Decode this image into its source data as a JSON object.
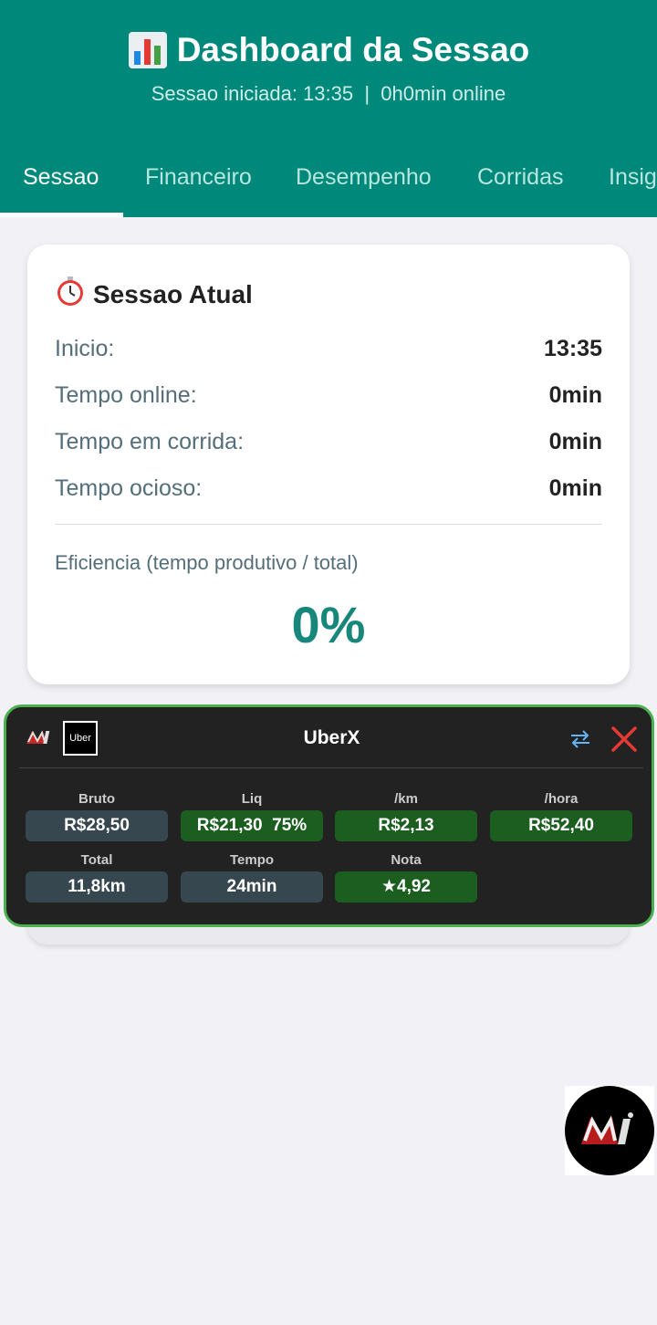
{
  "header": {
    "title": "Dashboard da Sessao",
    "subtitle": "Sessao iniciada: 13:35  |  0h0min online",
    "title_icon": "bar-chart-icon"
  },
  "tabs": [
    {
      "label": "Sessao",
      "active": true
    },
    {
      "label": "Financeiro",
      "active": false
    },
    {
      "label": "Desempenho",
      "active": false
    },
    {
      "label": "Corridas",
      "active": false
    },
    {
      "label": "Insig",
      "active": false
    }
  ],
  "session_card": {
    "icon": "stopwatch-icon",
    "title": "Sessao Atual",
    "rows": [
      {
        "label": "Inicio:",
        "value": "13:35"
      },
      {
        "label": "Tempo online:",
        "value": "0min"
      },
      {
        "label": "Tempo em corrida:",
        "value": "0min"
      },
      {
        "label": "Tempo ocioso:",
        "value": "0min"
      }
    ],
    "efficiency_label": "Eficiencia (tempo produtivo / total)",
    "efficiency_value": "0%"
  },
  "ride_overlay": {
    "title": "UberX",
    "uber_logo_text": "Uber",
    "metrics_row1": [
      {
        "label": "Bruto",
        "value": "R$28,50",
        "style": "grey"
      },
      {
        "label": "Liq",
        "value": "R$21,30  75%",
        "style": "green"
      },
      {
        "label": "/km",
        "value": "R$2,13",
        "style": "green"
      },
      {
        "label": "/hora",
        "value": "R$52,40",
        "style": "green"
      }
    ],
    "metrics_row2": [
      {
        "label": "Total",
        "value": "11,8km",
        "style": "grey"
      },
      {
        "label": "Tempo",
        "value": "24min",
        "style": "grey"
      },
      {
        "label": "Nota",
        "value": "★4,92",
        "style": "green"
      }
    ]
  },
  "colors": {
    "header": "#00897b",
    "accent": "#16877a",
    "overlay_border": "#4caf50",
    "close": "#e53935"
  }
}
